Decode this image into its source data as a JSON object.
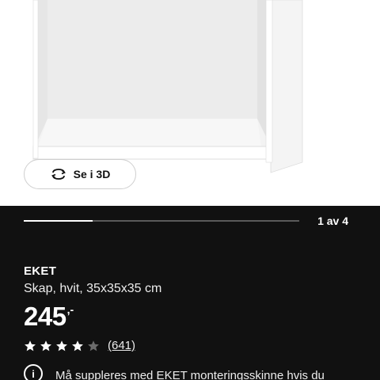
{
  "viewer": {
    "view_3d_label": "Se i 3D",
    "rotate_icon": "rotate-3d-icon",
    "slide_counter": "1 av 4",
    "slide_progress": 0.25
  },
  "product": {
    "name": "EKET",
    "description": "Skap, hvit, 35x35x35 cm",
    "price": "245",
    "price_suffix": ",-",
    "rating": 4,
    "rating_max": 5,
    "review_count": "(641)",
    "notice_icon": "info-icon",
    "notice_text": "Må suppleres med EKET monteringsskinne hvis du"
  },
  "colors": {
    "background_dark": "#111111",
    "text_light": "#ffffff",
    "star_filled": "#ffffff",
    "star_empty": "#6b6b6b"
  }
}
